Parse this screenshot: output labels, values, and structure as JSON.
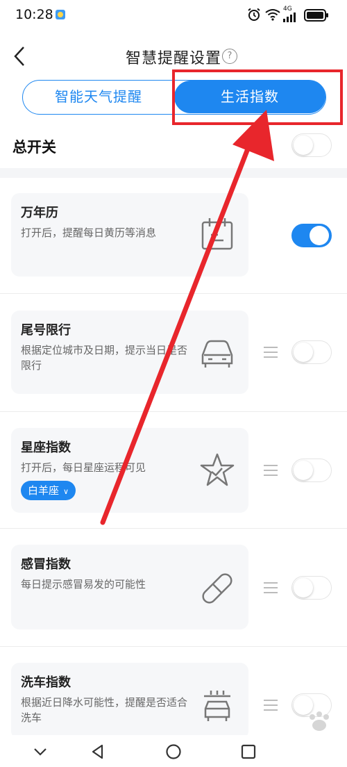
{
  "status_bar": {
    "time": "10:28",
    "network": "4G"
  },
  "header": {
    "title": "智慧提醒设置",
    "help_symbol": "?"
  },
  "tabs": [
    {
      "label": "智能天气提醒",
      "active": false
    },
    {
      "label": "生活指数",
      "active": true
    }
  ],
  "master_switch": {
    "label": "总开关",
    "on": false
  },
  "cards": [
    {
      "title": "万年历",
      "description": "打开后，提醒每日黄历等消息",
      "icon": "calendar-icon",
      "on": true
    },
    {
      "title": "尾号限行",
      "description": "根据定位城市及日期，提示当日是否限行",
      "icon": "car-icon",
      "on": false
    },
    {
      "title": "星座指数",
      "description": "打开后，每日星座运程可见",
      "icon": "star-icon",
      "on": false,
      "selected_sign": "白羊座"
    },
    {
      "title": "感冒指数",
      "description": "每日提示感冒易发的可能性",
      "icon": "pill-icon",
      "on": false
    },
    {
      "title": "洗车指数",
      "description": "根据近日降水可能性，提醒是否适合洗车",
      "icon": "car-wash-icon",
      "on": false
    }
  ],
  "colors": {
    "accent": "#1e87f0",
    "annotation": "#e8262c",
    "card_bg": "#f6f7f9"
  }
}
